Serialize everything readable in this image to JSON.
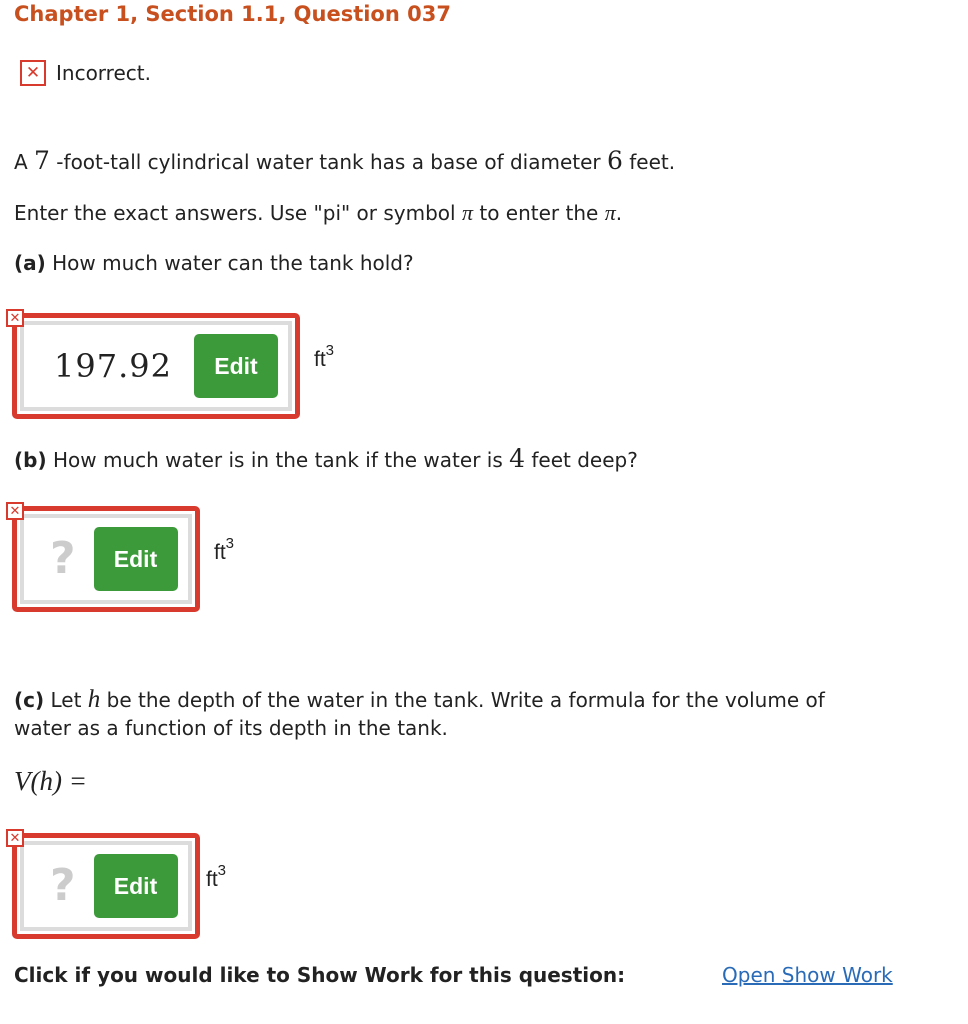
{
  "header": {
    "title": "Chapter 1, Section 1.1, Question 037"
  },
  "status": {
    "icon": "x-mark-icon",
    "text": "Incorrect."
  },
  "problem": {
    "line1": {
      "pre": "A ",
      "height": "7",
      "mid": " -foot-tall cylindrical water tank has a base of diameter ",
      "diameter": "6",
      "post": " feet."
    },
    "line2": {
      "pre": "Enter the exact answers. Use \"pi\" or symbol ",
      "pi": "π",
      "mid": " to enter the ",
      "pi2": "π",
      "post": "."
    }
  },
  "part_a": {
    "label": "(a)",
    "question": " How much water can the tank hold?",
    "answer": "197.92",
    "edit_label": "Edit",
    "unit": "ft",
    "unit_exp": "3"
  },
  "part_b": {
    "label": "(b)",
    "question_pre": " How much water is in the tank if the water is ",
    "depth": "4",
    "question_post": " feet deep?",
    "answer": "?",
    "edit_label": "Edit",
    "unit": "ft",
    "unit_exp": "3"
  },
  "part_c": {
    "label": "(c)",
    "question_pre": " Let ",
    "var": "h",
    "question_post": " be the depth of the water in the tank. Write a formula for the volume of",
    "question_line2": "water as a function of its depth in the tank.",
    "formula": "V(h) =",
    "answer": "?",
    "edit_label": "Edit",
    "unit": "ft",
    "unit_exp": "3"
  },
  "footer": {
    "label": "Click if you would like to Show Work for this question:",
    "link": "Open Show Work"
  },
  "colors": {
    "accent": "#c8501e",
    "error": "#d83a2e",
    "button": "#3c9a3a",
    "link": "#2a6bb8"
  }
}
